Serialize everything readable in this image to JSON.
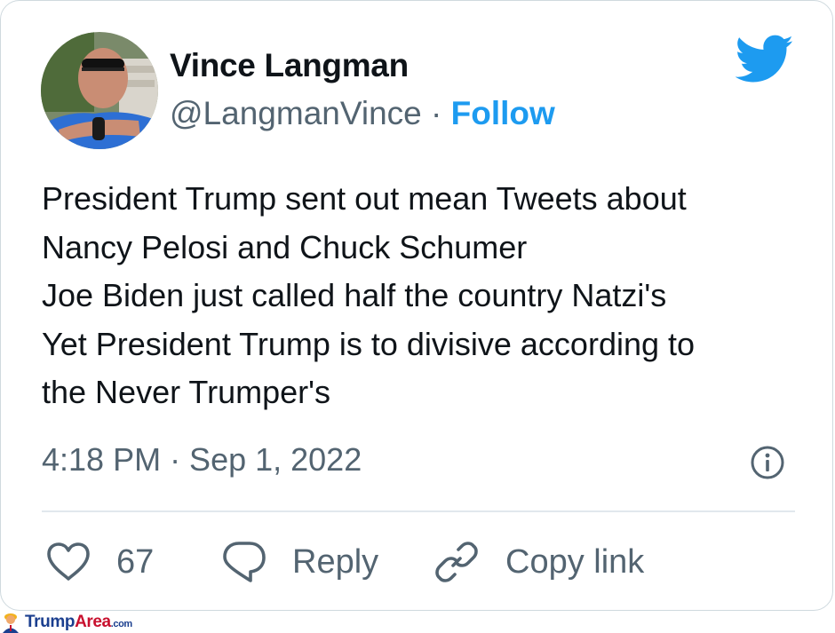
{
  "tweet": {
    "author": {
      "name": "Vince Langman",
      "handle": "@LangmanVince",
      "separator": " · ",
      "follow_label": "Follow"
    },
    "text_lines": [
      "President Trump sent out mean Tweets about",
      "Nancy Pelosi and Chuck Schumer",
      "Joe Biden just called half the country Natzi's",
      "Yet President Trump is to divisive according to",
      "the Never Trumper's"
    ],
    "timestamp": "4:18 PM · Sep 1, 2022",
    "actions": {
      "like_count": "67",
      "reply_label": "Reply",
      "copy_link_label": "Copy link"
    }
  },
  "colors": {
    "twitter_blue": "#1d9bf0",
    "text_primary": "#0f1419",
    "text_secondary": "#536471"
  },
  "watermark": {
    "brand_part1": "Trump",
    "brand_part2": "Area",
    "brand_suffix": ".com"
  }
}
